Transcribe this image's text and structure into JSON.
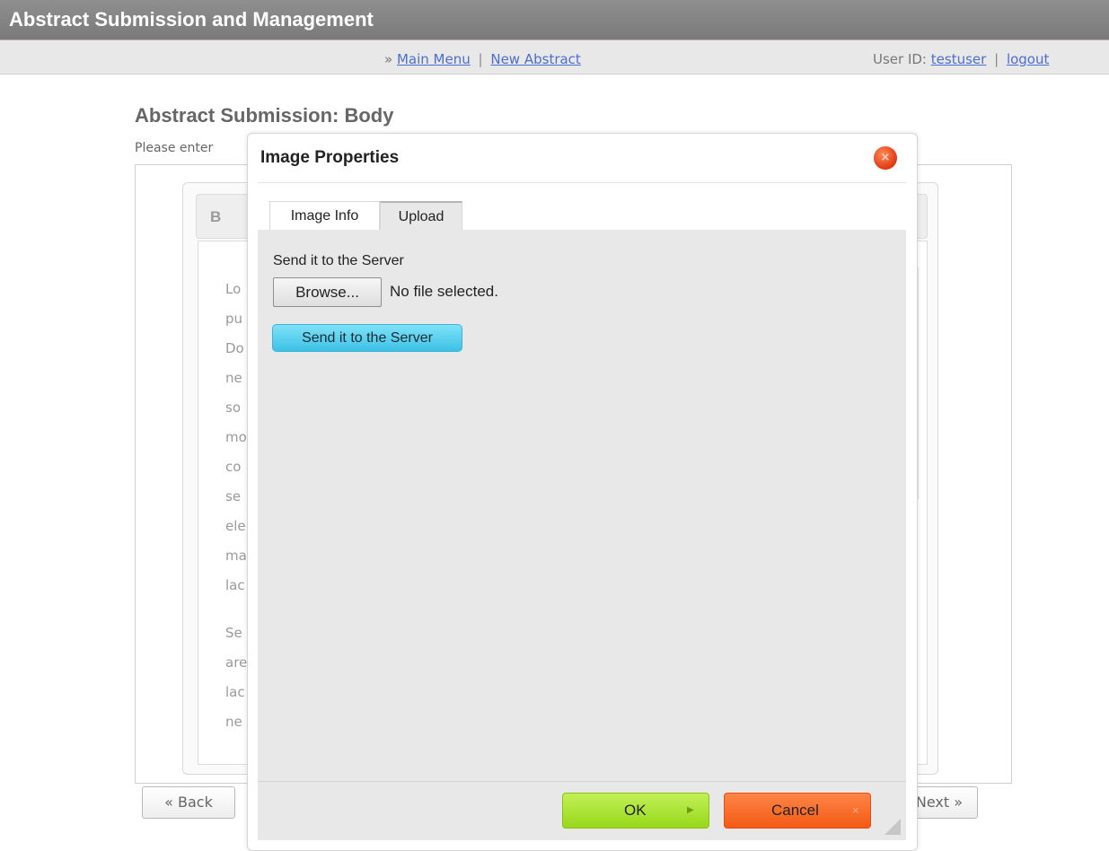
{
  "header": {
    "title": "Abstract Submission and Management"
  },
  "nav": {
    "chevron": "»",
    "main_menu": "Main Menu",
    "separator": "|",
    "new_abstract": "New Abstract",
    "user_id_label": "User ID:",
    "user_id": "testuser",
    "logout": "logout"
  },
  "page": {
    "heading": "Abstract Submission: Body",
    "instruction": "Please enter"
  },
  "editor": {
    "bold_button": "B",
    "body_lines": [
      "Lo",
      "pu",
      "Do",
      "ne",
      "so",
      "mo",
      "co",
      "se",
      "ele",
      "ma",
      "lac",
      "Se",
      "are",
      "lac",
      "ne"
    ]
  },
  "footer_nav": {
    "back": "« Back",
    "next": "Next »"
  },
  "dialog": {
    "title": "Image Properties",
    "close_symbol": "×",
    "tabs": [
      "Image Info",
      "Upload"
    ],
    "active_tab": "Upload",
    "upload_label": "Send it to the Server",
    "browse_button": "Browse...",
    "file_status": "No file selected.",
    "send_button": "Send it to the Server",
    "ok_button": "OK",
    "cancel_button": "Cancel"
  },
  "colors": {
    "header_bg": "#858585",
    "link": "#4c6ed0",
    "send_button": "#4fcbeb",
    "ok_button": "#a8e034",
    "cancel_button": "#f56a22",
    "close_button": "#e8451a"
  }
}
